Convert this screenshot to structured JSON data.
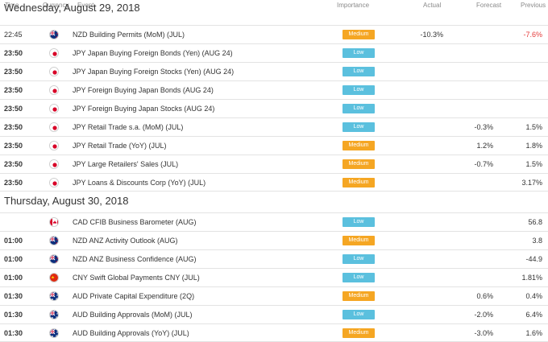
{
  "header": {
    "time": "Time",
    "currency": "Currency",
    "event": "Event",
    "importance": "Importance",
    "actual": "Actual",
    "forecast": "Forecast",
    "previous": "Previous"
  },
  "days": [
    {
      "title": "Wednesday, August 29, 2018",
      "rows": [
        {
          "time": "22:45",
          "bold": false,
          "flag": "nz",
          "event": "NZD Building Permits (MoM) (JUL)",
          "importance": "Medium",
          "actual": "-10.3%",
          "forecast": "",
          "previous": "-7.6%",
          "prev_negative": true
        },
        {
          "time": "23:50",
          "bold": true,
          "flag": "jp",
          "event": "JPY Japan Buying Foreign Bonds (Yen) (AUG 24)",
          "importance": "Low",
          "actual": "",
          "forecast": "",
          "previous": ""
        },
        {
          "time": "23:50",
          "bold": true,
          "flag": "jp",
          "event": "JPY Japan Buying Foreign Stocks (Yen) (AUG 24)",
          "importance": "Low",
          "actual": "",
          "forecast": "",
          "previous": ""
        },
        {
          "time": "23:50",
          "bold": true,
          "flag": "jp",
          "event": "JPY Foreign Buying Japan Bonds (AUG 24)",
          "importance": "Low",
          "actual": "",
          "forecast": "",
          "previous": ""
        },
        {
          "time": "23:50",
          "bold": true,
          "flag": "jp",
          "event": "JPY Foreign Buying Japan Stocks (AUG 24)",
          "importance": "Low",
          "actual": "",
          "forecast": "",
          "previous": ""
        },
        {
          "time": "23:50",
          "bold": true,
          "flag": "jp",
          "event": "JPY Retail Trade s.a. (MoM) (JUL)",
          "importance": "Low",
          "actual": "",
          "forecast": "-0.3%",
          "previous": "1.5%"
        },
        {
          "time": "23:50",
          "bold": true,
          "flag": "jp",
          "event": "JPY Retail Trade (YoY) (JUL)",
          "importance": "Medium",
          "actual": "",
          "forecast": "1.2%",
          "previous": "1.8%"
        },
        {
          "time": "23:50",
          "bold": true,
          "flag": "jp",
          "event": "JPY Large Retailers' Sales (JUL)",
          "importance": "Medium",
          "actual": "",
          "forecast": "-0.7%",
          "previous": "1.5%"
        },
        {
          "time": "23:50",
          "bold": true,
          "flag": "jp",
          "event": "JPY Loans & Discounts Corp (YoY) (JUL)",
          "importance": "Medium",
          "actual": "",
          "forecast": "",
          "previous": "3.17%"
        }
      ]
    },
    {
      "title": "Thursday, August 30, 2018",
      "rows": [
        {
          "time": "",
          "bold": true,
          "flag": "ca",
          "event": "CAD CFIB Business Barometer (AUG)",
          "importance": "Low",
          "actual": "",
          "forecast": "",
          "previous": "56.8"
        },
        {
          "time": "01:00",
          "bold": true,
          "flag": "nz",
          "event": "NZD ANZ Activity Outlook (AUG)",
          "importance": "Medium",
          "actual": "",
          "forecast": "",
          "previous": "3.8"
        },
        {
          "time": "01:00",
          "bold": true,
          "flag": "nz",
          "event": "NZD ANZ Business Confidence (AUG)",
          "importance": "Low",
          "actual": "",
          "forecast": "",
          "previous": "-44.9"
        },
        {
          "time": "01:00",
          "bold": true,
          "flag": "cn",
          "event": "CNY Swift Global Payments CNY (JUL)",
          "importance": "Low",
          "actual": "",
          "forecast": "",
          "previous": "1.81%"
        },
        {
          "time": "01:30",
          "bold": true,
          "flag": "au",
          "event": "AUD Private Capital Expenditure (2Q)",
          "importance": "Medium",
          "actual": "",
          "forecast": "0.6%",
          "previous": "0.4%"
        },
        {
          "time": "01:30",
          "bold": true,
          "flag": "au",
          "event": "AUD Building Approvals (MoM) (JUL)",
          "importance": "Low",
          "actual": "",
          "forecast": "-2.0%",
          "previous": "6.4%"
        },
        {
          "time": "01:30",
          "bold": true,
          "flag": "au",
          "event": "AUD Building Approvals (YoY) (JUL)",
          "importance": "Medium",
          "actual": "",
          "forecast": "-3.0%",
          "previous": "1.6%"
        }
      ]
    }
  ],
  "colors": {
    "medium": "#f5a623",
    "low": "#5bc0de",
    "negative": "#e43b3b"
  },
  "flag_icons": {
    "nz": "nz-flag-icon",
    "jp": "jp-flag-icon",
    "ca": "ca-flag-icon",
    "cn": "cn-flag-icon",
    "au": "au-flag-icon"
  }
}
